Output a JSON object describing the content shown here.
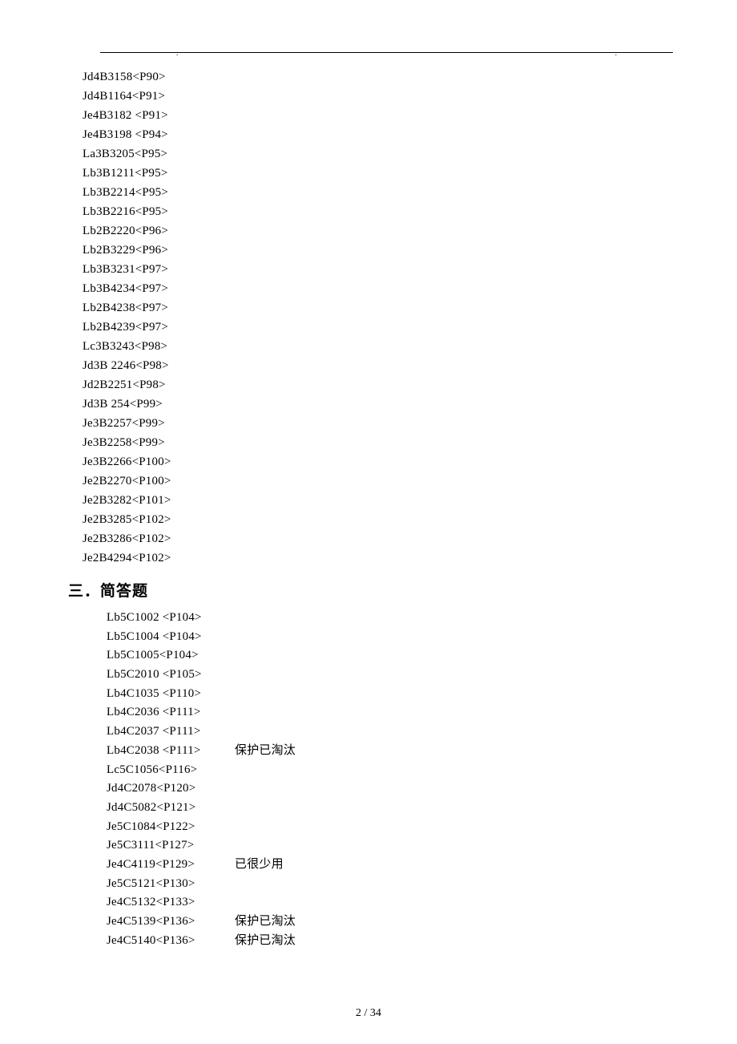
{
  "list1": [
    "Jd4B3158<P90>",
    "Jd4B1164<P91>",
    "Je4B3182 <P91>",
    "Je4B3198 <P94>",
    "La3B3205<P95>",
    "Lb3B1211<P95>",
    "Lb3B2214<P95>",
    "Lb3B2216<P95>",
    "Lb2B2220<P96>",
    "Lb2B3229<P96>",
    "Lb3B3231<P97>",
    "Lb3B4234<P97>",
    "Lb2B4238<P97>",
    "Lb2B4239<P97>",
    "Lc3B3243<P98>",
    "Jd3B 2246<P98>",
    "Jd2B2251<P98>",
    "Jd3B 254<P99>",
    "Je3B2257<P99>",
    "Je3B2258<P99>",
    "Je3B2266<P100>",
    "Je2B2270<P100>",
    "Je2B3282<P101>",
    "Je2B3285<P102>",
    "Je2B3286<P102>",
    "Je2B4294<P102>"
  ],
  "section_heading": "三．简答题",
  "list2": [
    {
      "code": "Lb5C1002 <P104>",
      "note": ""
    },
    {
      "code": "Lb5C1004 <P104>",
      "note": ""
    },
    {
      "code": "Lb5C1005<P104>",
      "note": ""
    },
    {
      "code": "Lb5C2010 <P105>",
      "note": ""
    },
    {
      "code": "Lb4C1035 <P110>",
      "note": ""
    },
    {
      "code": "Lb4C2036 <P111>",
      "note": ""
    },
    {
      "code": "Lb4C2037 <P111>",
      "note": ""
    },
    {
      "code": "Lb4C2038 <P111>",
      "note": "保护已淘汰"
    },
    {
      "code": "Lc5C1056<P116>",
      "note": ""
    },
    {
      "code": "Jd4C2078<P120>",
      "note": ""
    },
    {
      "code": "Jd4C5082<P121>",
      "note": ""
    },
    {
      "code": "Je5C1084<P122>",
      "note": ""
    },
    {
      "code": "Je5C3111<P127>",
      "note": ""
    },
    {
      "code": "Je4C4119<P129>",
      "note": "已很少用"
    },
    {
      "code": "Je5C5121<P130>",
      "note": ""
    },
    {
      "code": "Je4C5132<P133>",
      "note": ""
    },
    {
      "code": "Je4C5139<P136>",
      "note": "保护已淘汰"
    },
    {
      "code": "Je4C5140<P136>",
      "note": "  保护已淘汰"
    }
  ],
  "footer": "2  /  34"
}
